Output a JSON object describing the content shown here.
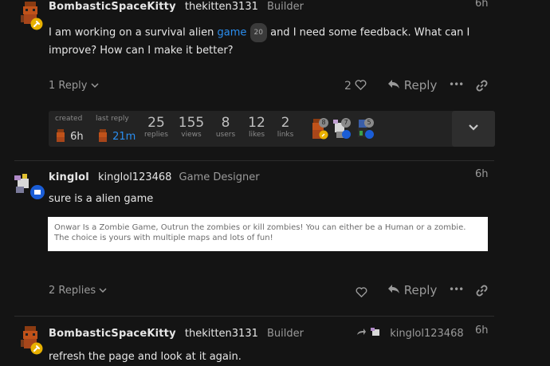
{
  "post1": {
    "username": "BombasticSpaceKitty",
    "handle": "thekitten3131",
    "title": "Builder",
    "time": "6h",
    "body_before": "I am working on a survival alien ",
    "body_link": "game",
    "body_link_count": "20",
    "body_line1_after": " and I need some feedback. What can I",
    "body_line2": "improve? How can I make it better?",
    "replies_toggle": "1 Reply",
    "like_count": "2",
    "reply_label": "Reply",
    "more_label": "•••"
  },
  "topic_map": {
    "created_label": "created",
    "created_value": "6h",
    "last_reply_label": "last reply",
    "last_reply_value": "21m",
    "stats": [
      {
        "num": "25",
        "label": "replies"
      },
      {
        "num": "155",
        "label": "views"
      },
      {
        "num": "8",
        "label": "users"
      },
      {
        "num": "12",
        "label": "likes"
      },
      {
        "num": "2",
        "label": "links"
      }
    ],
    "participants": [
      {
        "count": "8"
      },
      {
        "count": "7"
      },
      {
        "count": "5"
      }
    ]
  },
  "post2": {
    "username": "kinglol",
    "handle": "kinglol123468",
    "title": "Game Designer",
    "time": "6h",
    "body": "sure is a alien game",
    "preview_text": "Onwar Is a Zombie Game, Outrun the zombies or kill zombies! You can either be a Human or a zombie. The choice is yours with multiple maps and lots of fun!",
    "replies_toggle": "2 Replies",
    "reply_label": "Reply",
    "more_label": "•••"
  },
  "post3": {
    "username": "BombasticSpaceKitty",
    "handle": "thekitten3131",
    "title": "Builder",
    "reply_to": "kinglol123468",
    "time": "6h",
    "body": "refresh the page and look at it again."
  },
  "colors": {
    "background": "#141414",
    "link": "#2a8ef0",
    "badge_yellow": "#e8b100",
    "badge_blue": "#1a5dd6"
  }
}
